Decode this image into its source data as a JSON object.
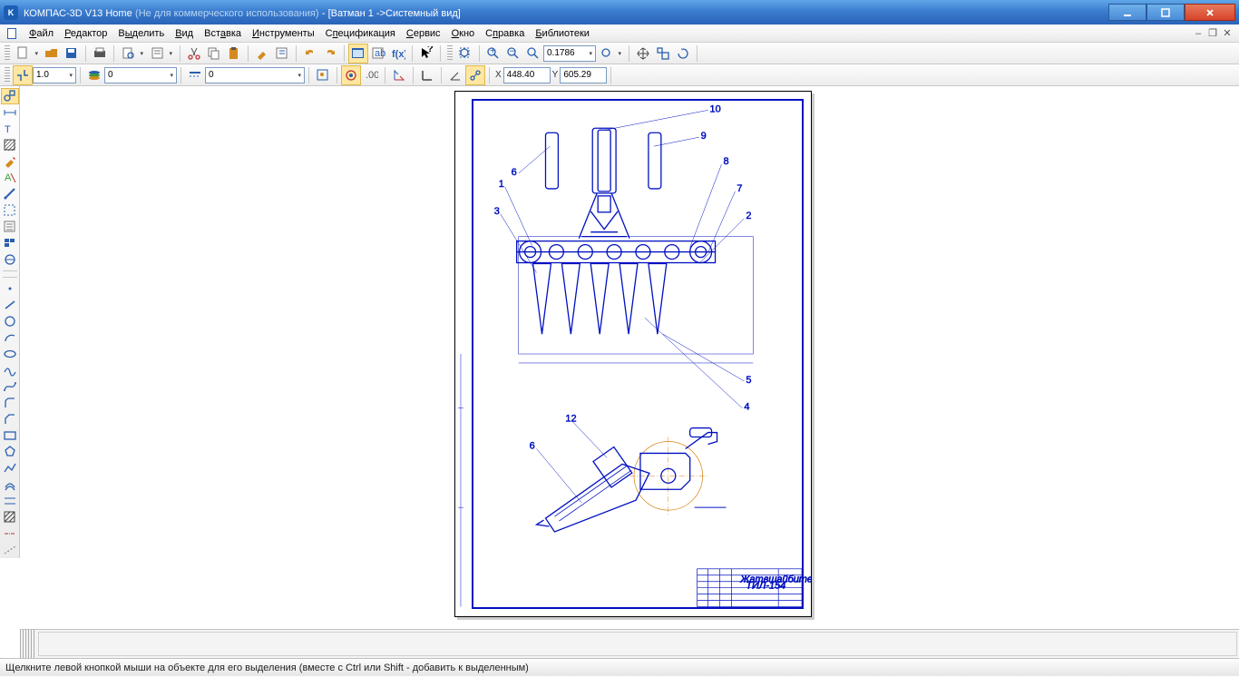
{
  "title": {
    "app": "КОМПАС-3D V13 Home",
    "note": "(Не для коммерческого использования)",
    "doc": "[Ватман 1 ->Системный вид]"
  },
  "menu": [
    "Файл",
    "Редактор",
    "Выделить",
    "Вид",
    "Вставка",
    "Инструменты",
    "Спецификация",
    "Сервис",
    "Окно",
    "Справка",
    "Библиотеки"
  ],
  "tb1": {
    "zoom": "0.1786"
  },
  "tb2": {
    "scale": "1.0",
    "layer": "0",
    "linestyle": "0",
    "xlbl": "X",
    "x": "448.40",
    "ylbl": "Y",
    "y": "605.29"
  },
  "titleblock": {
    "l1": "Жатвшайбите",
    "l2": "ТИЛ-154"
  },
  "status": "Щелкните левой кнопкой мыши на объекте для его выделения (вместе с Ctrl или Shift - добавить к выделенным)"
}
